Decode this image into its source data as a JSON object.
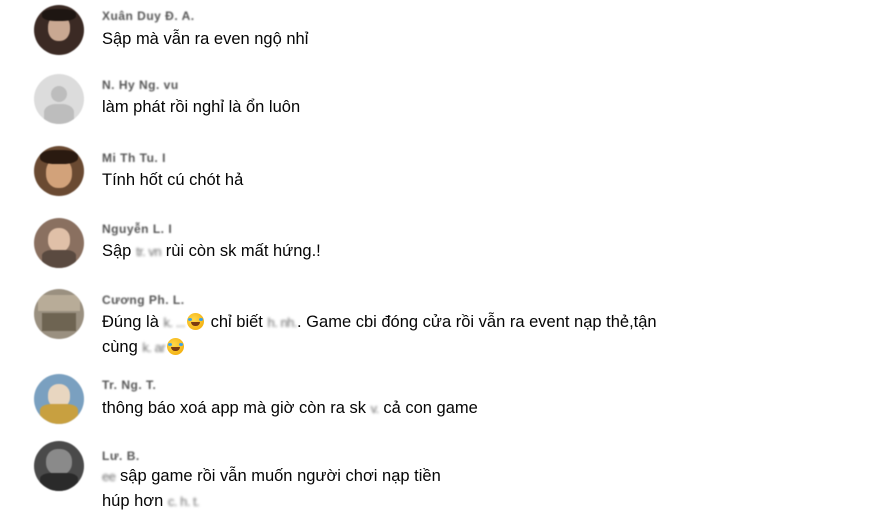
{
  "comments": [
    {
      "name_masked": "Xuân Duy Đ. A.",
      "parts": [
        {
          "t": "Sập mà vẫn ra even ngộ nhỉ"
        }
      ],
      "avatar_color": "#3b2a24"
    },
    {
      "name_masked": "N. Hy Ng. vu",
      "parts": [
        {
          "t": "làm phát rồi nghỉ là ổn luôn"
        }
      ],
      "avatar_color": "#d9d9d9"
    },
    {
      "name_masked": "Mi Th Tu. I",
      "parts": [
        {
          "t": "Tính hốt cú chót hả"
        }
      ],
      "avatar_color": "#6a4a32"
    },
    {
      "name_masked": "Nguyễn L. I",
      "parts": [
        {
          "t": "Sập "
        },
        {
          "blur": "tr. vn"
        },
        {
          "t": " rùi còn sk mất hứng.!"
        }
      ],
      "avatar_color": "#8a7060"
    },
    {
      "name_masked": "Cương Ph. L.",
      "line1": [
        {
          "t": "Đúng là "
        },
        {
          "blur": "k. ..."
        },
        {
          "emoji": "rofl"
        },
        {
          "t": " chỉ biết "
        },
        {
          "blur": "h. nh."
        },
        {
          "t": ". Game cbi đóng cửa rồi vẫn ra event nạp thẻ,tận"
        }
      ],
      "line2": [
        {
          "t": "cùng "
        },
        {
          "blur": "k. ar"
        },
        {
          "emoji": "rofl"
        }
      ],
      "avatar_color": "#9a9080"
    },
    {
      "name_masked": "Tr. Ng. T.",
      "parts": [
        {
          "t": "thông báo xoá app mà giờ còn ra sk "
        },
        {
          "blur": "v."
        },
        {
          "t": " cả con game"
        }
      ],
      "avatar_color": "#7aa0c0"
    },
    {
      "name_masked": "Lư. B.",
      "line1": [
        {
          "blur": "ee"
        },
        {
          "t": " sập game rồi vẫn muốn người chơi nạp tiền"
        }
      ],
      "line2": [
        {
          "t": "húp hơn "
        },
        {
          "blur": "c. h. t."
        }
      ],
      "avatar_color": "#4a4a4a"
    }
  ],
  "emoji_name": "rolling-on-the-floor-laughing-icon"
}
